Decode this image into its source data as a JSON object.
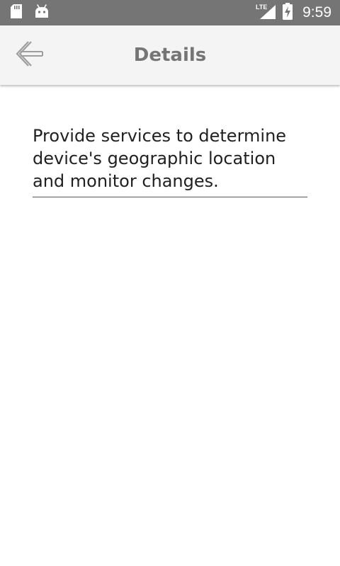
{
  "status_bar": {
    "time": "9:59",
    "network_label": "LTE",
    "icons": [
      "sd-card-icon",
      "android-icon",
      "lte-signal-icon",
      "battery-charging-icon"
    ]
  },
  "app_bar": {
    "title": "Details",
    "back_icon": "back-arrow-icon"
  },
  "main": {
    "description": "Provide services to determine device's geographic location and monitor changes."
  },
  "colors": {
    "status_bar": "#757575",
    "app_bar": "#f4f4f4",
    "title_text": "#757575",
    "body_text": "#212121",
    "background": "#ffffff"
  }
}
